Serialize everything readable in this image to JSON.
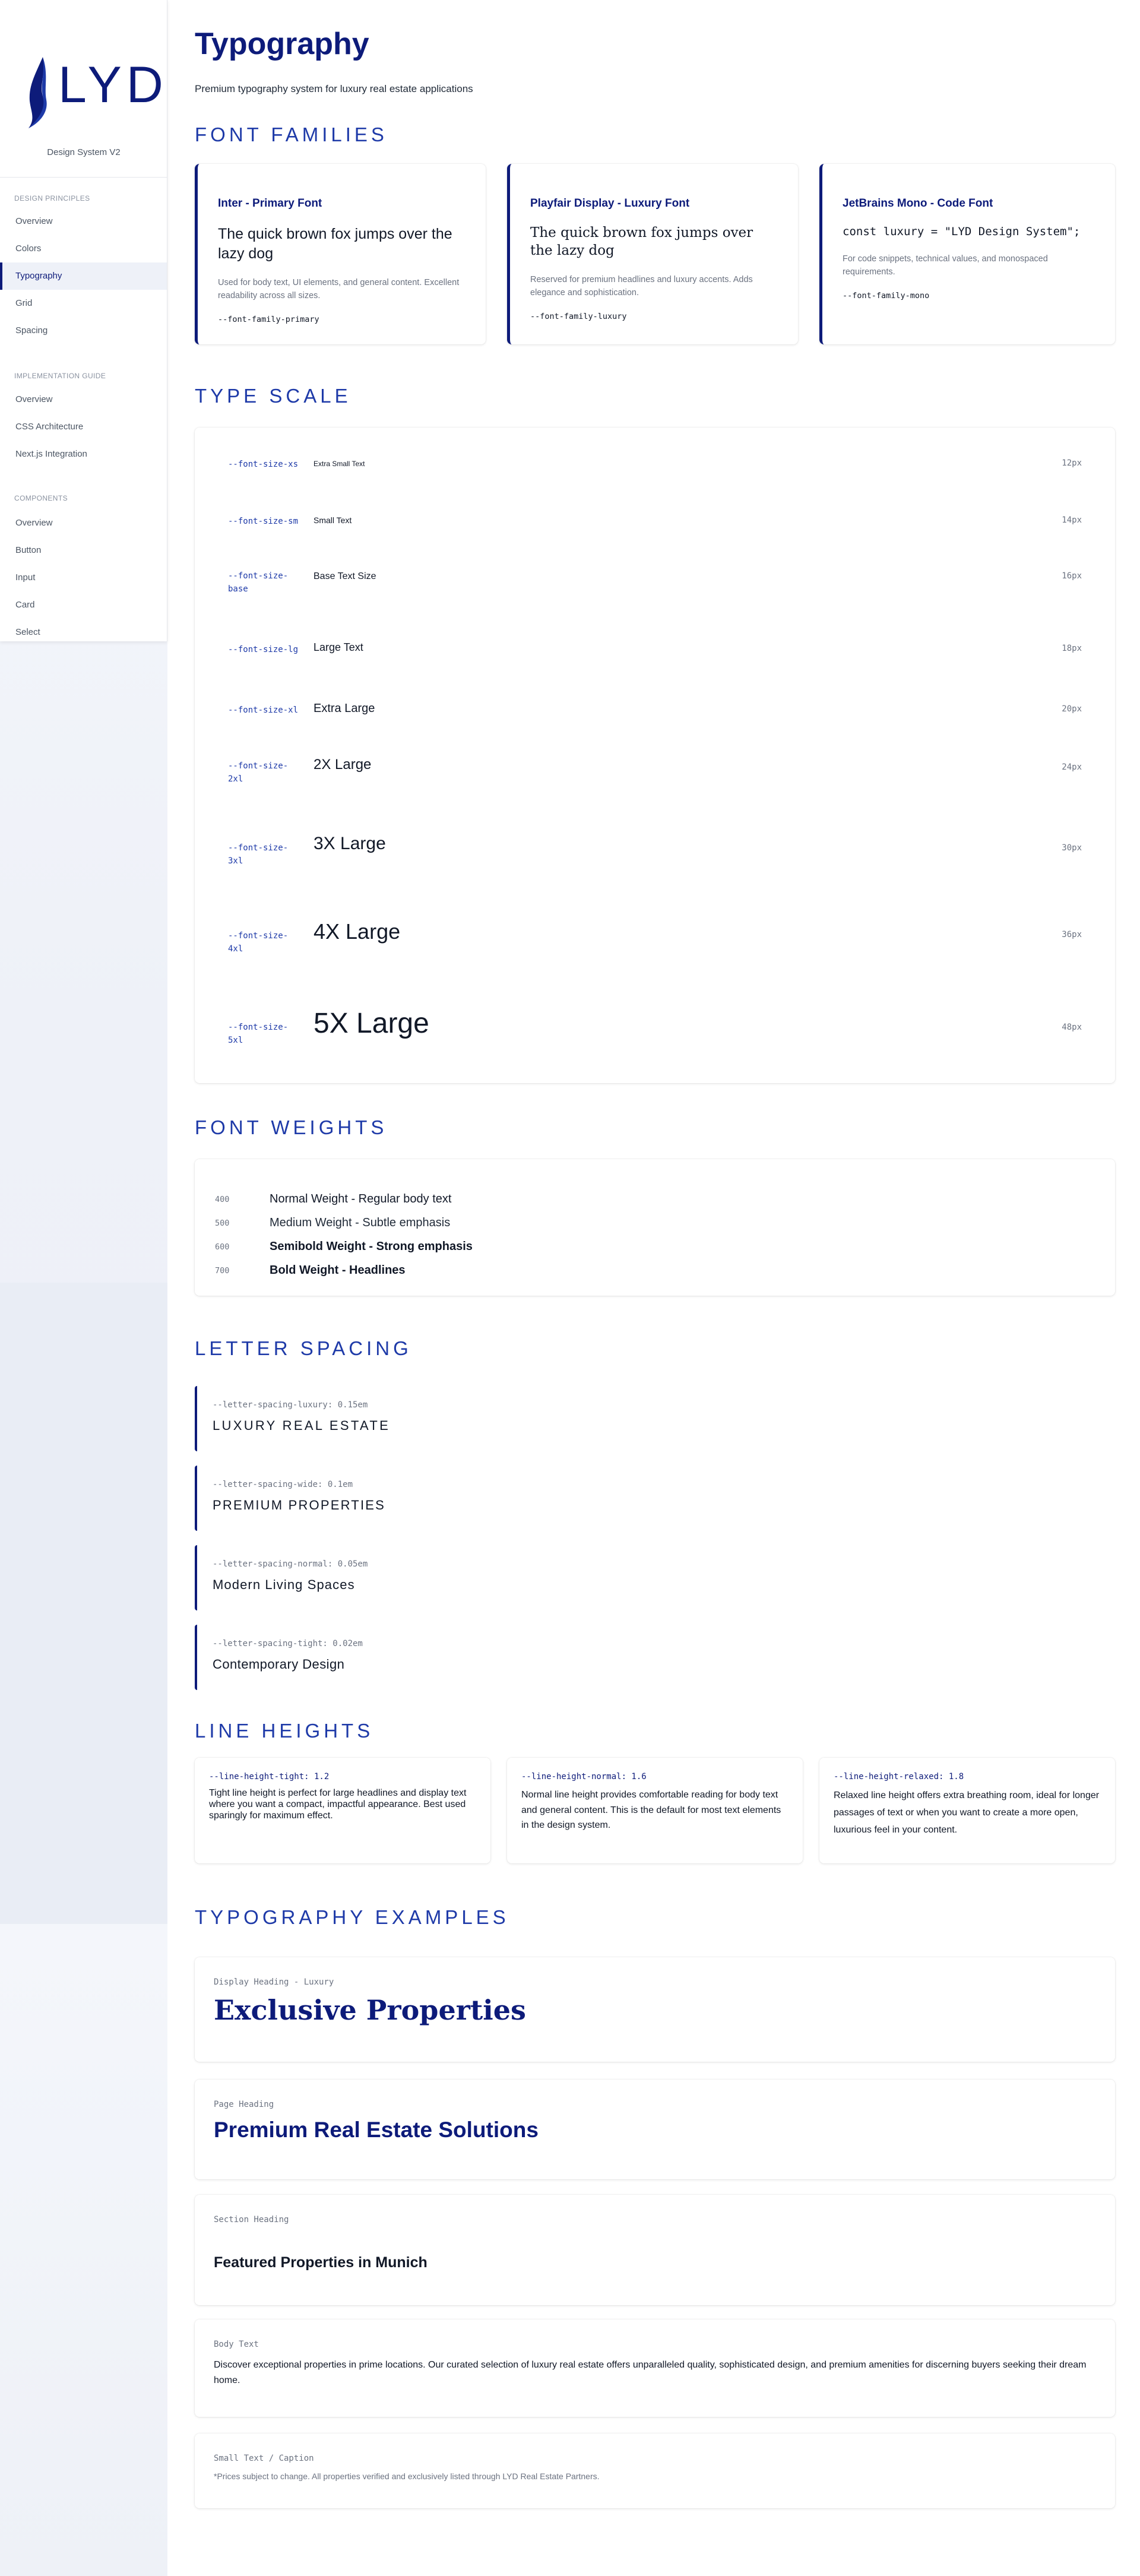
{
  "sidebar": {
    "logo_text": "LYD",
    "version": "Design System V2",
    "sections": [
      {
        "title": "Design Principles",
        "items": [
          "Overview",
          "Colors",
          "Typography",
          "Grid",
          "Spacing"
        ]
      },
      {
        "title": "Implementation Guide",
        "items": [
          "Overview",
          "CSS Architecture",
          "Next.js Integration"
        ]
      },
      {
        "title": "Components",
        "items": [
          "Overview",
          "Button",
          "Input",
          "Card",
          "Select"
        ]
      }
    ],
    "active_item": "Typography"
  },
  "header": {
    "title": "Typography",
    "subtitle": "Premium typography system for luxury real estate applications"
  },
  "font_families": {
    "heading": "Font Families",
    "cards": [
      {
        "title": "Inter - Primary Font",
        "sample": "The quick brown fox jumps over the lazy dog",
        "description": "Used for body text, UI elements, and general content. Excellent readability across all sizes.",
        "variable": "--font-family-primary"
      },
      {
        "title": "Playfair Display - Luxury Font",
        "sample": "The quick brown fox jumps over the lazy dog",
        "description": "Reserved for premium headlines and luxury accents. Adds elegance and sophistication.",
        "variable": "--font-family-luxury"
      },
      {
        "title": "JetBrains Mono - Code Font",
        "sample": "const luxury = \"LYD Design System\";",
        "description": "For code snippets, technical values, and monospaced requirements.",
        "variable": "--font-family-mono"
      }
    ]
  },
  "type_scale": {
    "heading": "Type Scale",
    "rows": [
      {
        "var_a": "--font-size-xs",
        "var_b": "",
        "sample": "Extra Small Text",
        "px": "12px"
      },
      {
        "var_a": "--font-size-sm",
        "var_b": "",
        "sample": "Small Text",
        "px": "14px"
      },
      {
        "var_a": "--font-size-",
        "var_b": "base",
        "sample": "Base Text Size",
        "px": "16px"
      },
      {
        "var_a": "--font-size-lg",
        "var_b": "",
        "sample": "Large Text",
        "px": "18px"
      },
      {
        "var_a": "--font-size-xl",
        "var_b": "",
        "sample": "Extra Large",
        "px": "20px"
      },
      {
        "var_a": "--font-size-",
        "var_b": "2xl",
        "sample": "2X Large",
        "px": "24px"
      },
      {
        "var_a": "--font-size-",
        "var_b": "3xl",
        "sample": "3X Large",
        "px": "30px"
      },
      {
        "var_a": "--font-size-",
        "var_b": "4xl",
        "sample": "4X Large",
        "px": "36px"
      },
      {
        "var_a": "--font-size-",
        "var_b": "5xl",
        "sample": "5X Large",
        "px": "48px"
      }
    ]
  },
  "font_weights": {
    "heading": "Font Weights",
    "rows": [
      {
        "weight": "400",
        "label": "Normal Weight - Regular body text"
      },
      {
        "weight": "500",
        "label": "Medium Weight - Subtle emphasis"
      },
      {
        "weight": "600",
        "label": "Semibold Weight - Strong emphasis"
      },
      {
        "weight": "700",
        "label": "Bold Weight - Headlines"
      }
    ]
  },
  "letter_spacing": {
    "heading": "Letter Spacing",
    "rows": [
      {
        "variable": "--letter-spacing-luxury: 0.15em",
        "sample": "LUXURY REAL ESTATE"
      },
      {
        "variable": "--letter-spacing-wide: 0.1em",
        "sample": "PREMIUM PROPERTIES"
      },
      {
        "variable": "--letter-spacing-normal: 0.05em",
        "sample": "Modern Living Spaces"
      },
      {
        "variable": "--letter-spacing-tight: 0.02em",
        "sample": "Contemporary Design"
      }
    ]
  },
  "line_heights": {
    "heading": "Line Heights",
    "cards": [
      {
        "variable": "--line-height-tight: 1.2",
        "text": "Tight line height is perfect for large headlines and display text where you want a compact, impactful appearance. Best used sparingly for maximum effect."
      },
      {
        "variable": "--line-height-normal: 1.6",
        "text": "Normal line height provides comfortable reading for body text and general content. This is the default for most text elements in the design system."
      },
      {
        "variable": "--line-height-relaxed: 1.8",
        "text": "Relaxed line height offers extra breathing room, ideal for longer passages of text or when you want to create a more open, luxurious feel in your content."
      }
    ]
  },
  "examples": {
    "heading": "Typography Examples",
    "items": [
      {
        "label": "Display Heading - Luxury",
        "content": "Exclusive Properties"
      },
      {
        "label": "Page Heading",
        "content": "Premium Real Estate Solutions"
      },
      {
        "label": "Section Heading",
        "content": "Featured Properties in Munich"
      },
      {
        "label": "Body Text",
        "content": "Discover exceptional properties in prime locations. Our curated selection of luxury real estate offers unparalleled quality, sophisticated design, and premium amenities for discerning buyers seeking their dream home."
      },
      {
        "label": "Small Text / Caption",
        "content": "*Prices subject to change. All properties verified and exclusively listed through LYD Real Estate Partners."
      }
    ]
  },
  "colors": {
    "brand": "#0d1b7a",
    "accent": "#1e3aa8"
  }
}
